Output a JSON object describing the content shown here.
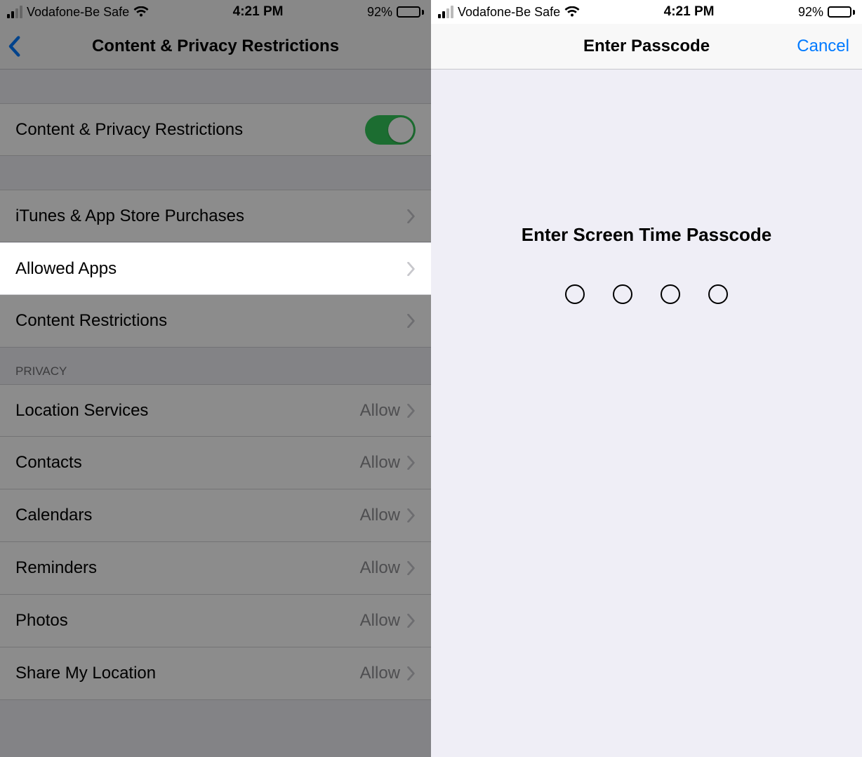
{
  "status": {
    "carrier": "Vodafone-Be Safe",
    "time": "4:21 PM",
    "battery_pct": "92%"
  },
  "left": {
    "nav_title": "Content & Privacy Restrictions",
    "toggle_row": {
      "label": "Content & Privacy Restrictions",
      "on": true
    },
    "rows": [
      {
        "label": "iTunes & App Store Purchases"
      },
      {
        "label": "Allowed Apps"
      },
      {
        "label": "Content Restrictions"
      }
    ],
    "privacy_header": "Privacy",
    "privacy_rows": [
      {
        "label": "Location Services",
        "value": "Allow"
      },
      {
        "label": "Contacts",
        "value": "Allow"
      },
      {
        "label": "Calendars",
        "value": "Allow"
      },
      {
        "label": "Reminders",
        "value": "Allow"
      },
      {
        "label": "Photos",
        "value": "Allow"
      },
      {
        "label": "Share My Location",
        "value": "Allow"
      }
    ]
  },
  "right": {
    "nav_title": "Enter Passcode",
    "cancel": "Cancel",
    "prompt": "Enter Screen Time Passcode",
    "digits": 4
  }
}
